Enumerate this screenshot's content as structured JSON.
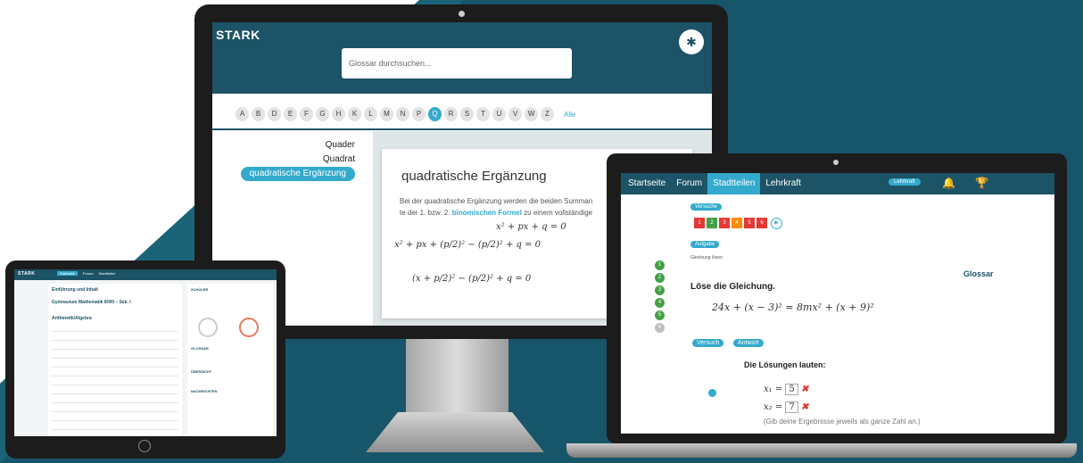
{
  "colors": {
    "brand_dark": "#1d5366",
    "accent": "#33aacc",
    "background_shape": "#17566a"
  },
  "monitor": {
    "brand": "STARK",
    "search_placeholder": "Glossar durchsuchen...",
    "gear_icon": "gear-icon",
    "letters": [
      "A",
      "B",
      "D",
      "E",
      "F",
      "G",
      "H",
      "K",
      "L",
      "M",
      "N",
      "P",
      "Q",
      "R",
      "S",
      "T",
      "U",
      "V",
      "W",
      "Z"
    ],
    "active_letter": "Q",
    "all_label": "Alle",
    "terms": [
      "Quader",
      "Quadrat",
      "quadratische Ergänzung"
    ],
    "card": {
      "title": "quadratische Ergänzung",
      "text_1": "Bei der quadratische Ergänzung werden die beiden Summan",
      "text_2a": "te der 1. bzw. 2. ",
      "text_2_link": "binomischen Formel",
      "text_2b": " zu einem vollständige",
      "eq_1": "x² + px + q = 0",
      "eq_2": "x² + px + (p/2)² − (p/2)² + q = 0",
      "eq_3": "(x + p/2)² − (p/2)² + q = 0"
    }
  },
  "tablet": {
    "brand": "STARK",
    "nav": [
      "Startseite",
      "Forum",
      "Stadtteilen"
    ],
    "course_1": "Einführung und Inhalt",
    "course_2": "Gymnasium Mathematik 8/9/II – Sek. I",
    "section": "Arithmetik/Algebra",
    "right_1": "SCHÜLER",
    "right_2": "GLOSSAR",
    "right_3": "ÜBERSICHT",
    "right_4": "NACHRICHTEN"
  },
  "laptop": {
    "nav": [
      "Startseite",
      "Forum",
      "Stadtteilen",
      "Lehrkraft"
    ],
    "active_nav": "Stadtteilen",
    "lehrkraft_pill": "Lehrkraft",
    "versuche_label": "Versuche",
    "attempts": [
      "1",
      "2",
      "3",
      "4",
      "5",
      "6"
    ],
    "attempt_colors": [
      "#e53935",
      "#43a047",
      "#e53935",
      "#fb8c00",
      "#e53935",
      "#e53935"
    ],
    "aufgabe_label": "Aufgabe",
    "task_hint": "Gleichung lösen",
    "glossar_link": "Glossar",
    "task_title": "Löse die Gleichung.",
    "equation": "24x + (x − 3)² = 8mx² + (x + 9)²",
    "step_numbers": [
      "1",
      "2",
      "3",
      "4",
      "5",
      "6"
    ],
    "versuch_button": "Versuch",
    "antwort_button": "Antwort",
    "solutions_title": "Die Lösungen lauten:",
    "x1_label": "x₁ =",
    "x1_value": "5",
    "x2_label": "x₂ =",
    "x2_value": "7",
    "hint": "(Gib deine Ergebnisse jeweils als ganze Zahl an.)"
  }
}
